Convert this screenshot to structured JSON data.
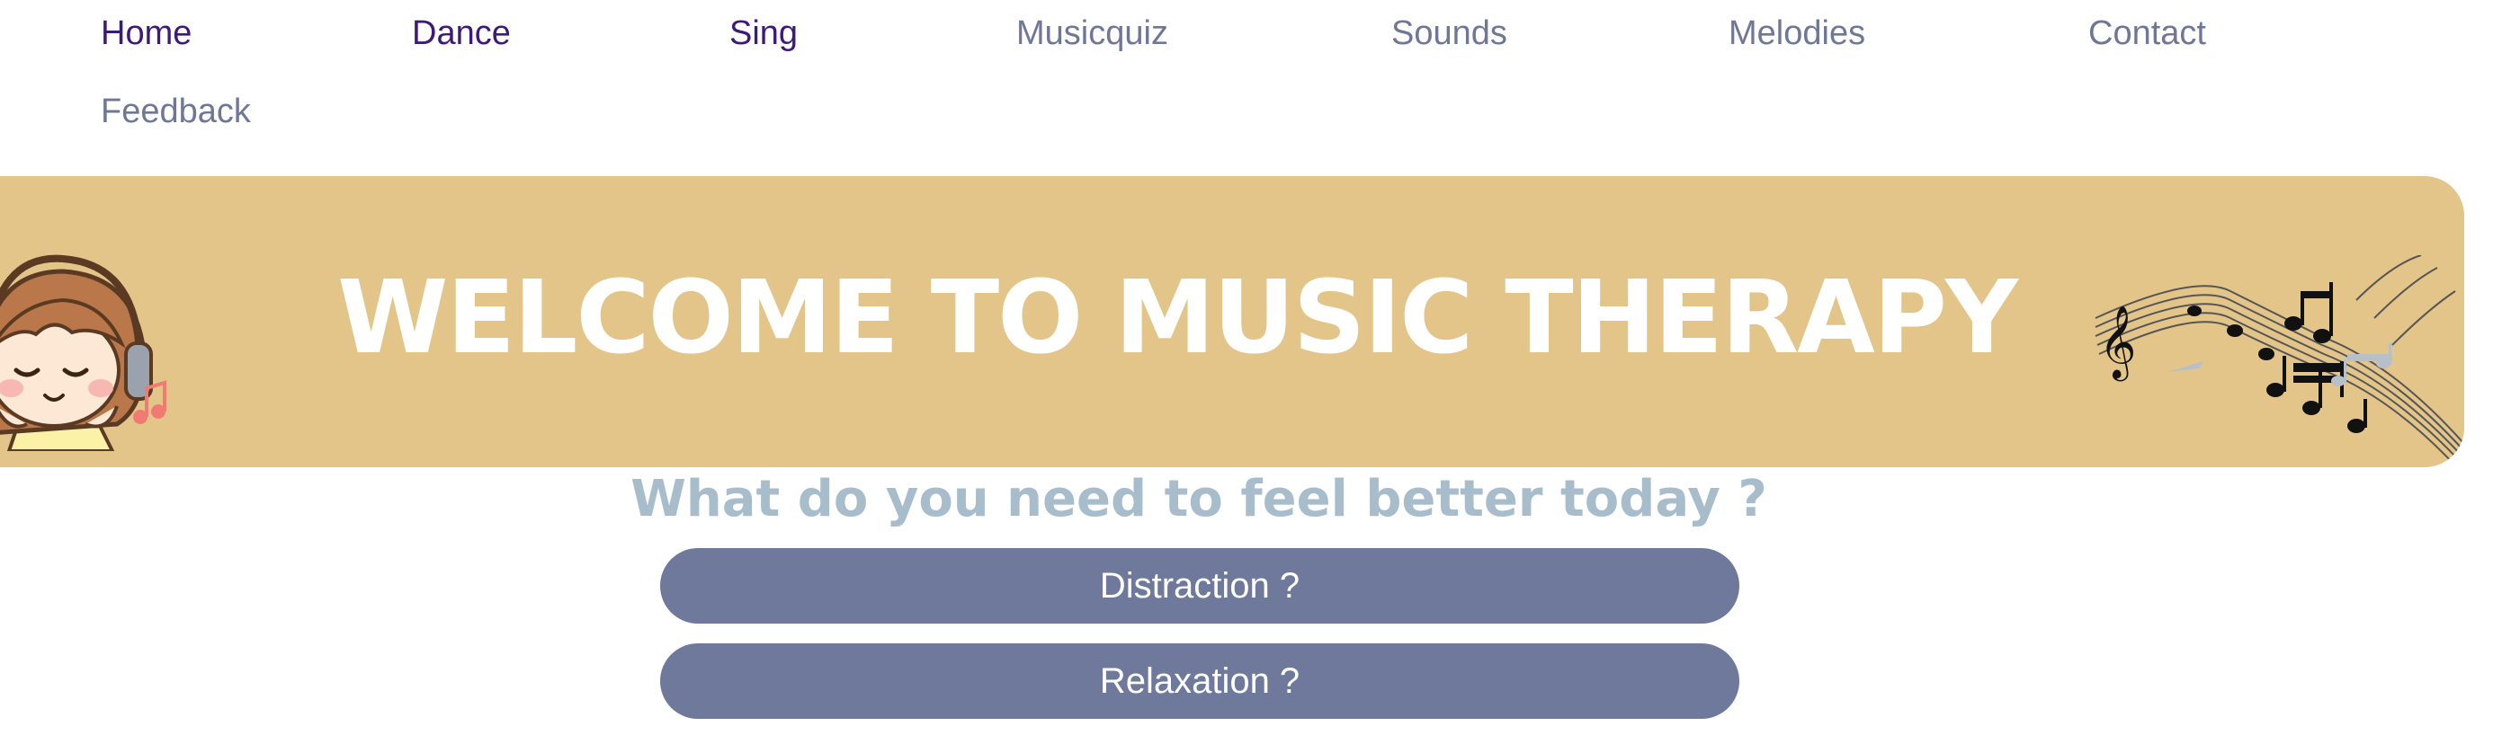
{
  "nav": {
    "items": [
      {
        "label": "Home"
      },
      {
        "label": "Dance"
      },
      {
        "label": "Sing"
      },
      {
        "label": "Musicquiz"
      },
      {
        "label": "Sounds"
      },
      {
        "label": "Melodies"
      },
      {
        "label": "Contact"
      },
      {
        "label": "Feedback"
      }
    ]
  },
  "banner": {
    "title": "WELCOME TO MUSIC THERAPY"
  },
  "main": {
    "question": "What do you need to feel better today ?",
    "options": [
      {
        "label": "Distraction ?"
      },
      {
        "label": "Relaxation ?"
      }
    ]
  },
  "colors": {
    "banner_bg": "#e3c589",
    "button_bg": "#6e799c",
    "question_text": "#a8bdcb",
    "nav_visited": "#3d1a7a",
    "nav_link": "#6f7797"
  },
  "icons": [
    "girl-with-headphones-illustration",
    "music-notes-illustration"
  ]
}
